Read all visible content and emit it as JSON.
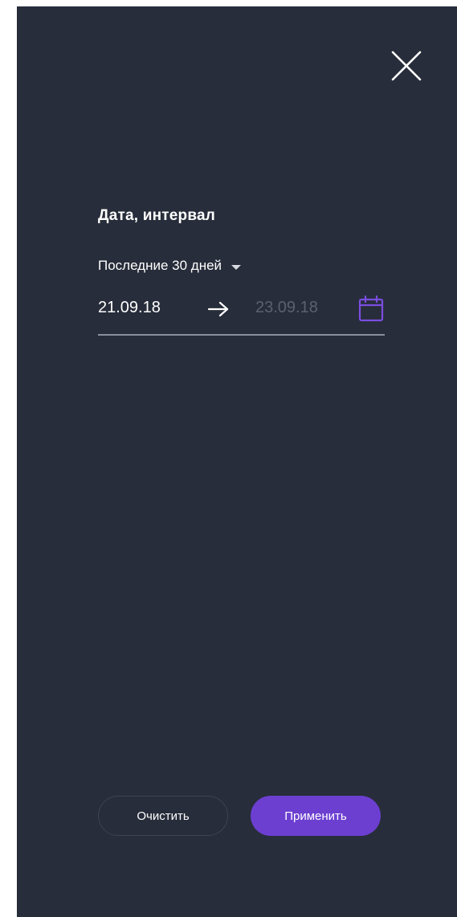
{
  "filter": {
    "close_icon": "close-icon",
    "section_title": "Дата, интервал",
    "period": {
      "selected": "Последние 30 дней",
      "icon": "chevron-down-icon"
    },
    "date_range": {
      "from_value": "21.09.18",
      "arrow_icon": "arrow-right-icon",
      "to_placeholder": "23.09.18",
      "calendar_icon": "calendar-icon"
    },
    "actions": {
      "clear_label": "Очистить",
      "apply_label": "Применить"
    }
  },
  "colors": {
    "background": "#272d3a",
    "accent": "#6c3fd1",
    "calendar_icon": "#7b4de0",
    "muted_text": "#5b6170",
    "underline": "#8a8f9c"
  }
}
